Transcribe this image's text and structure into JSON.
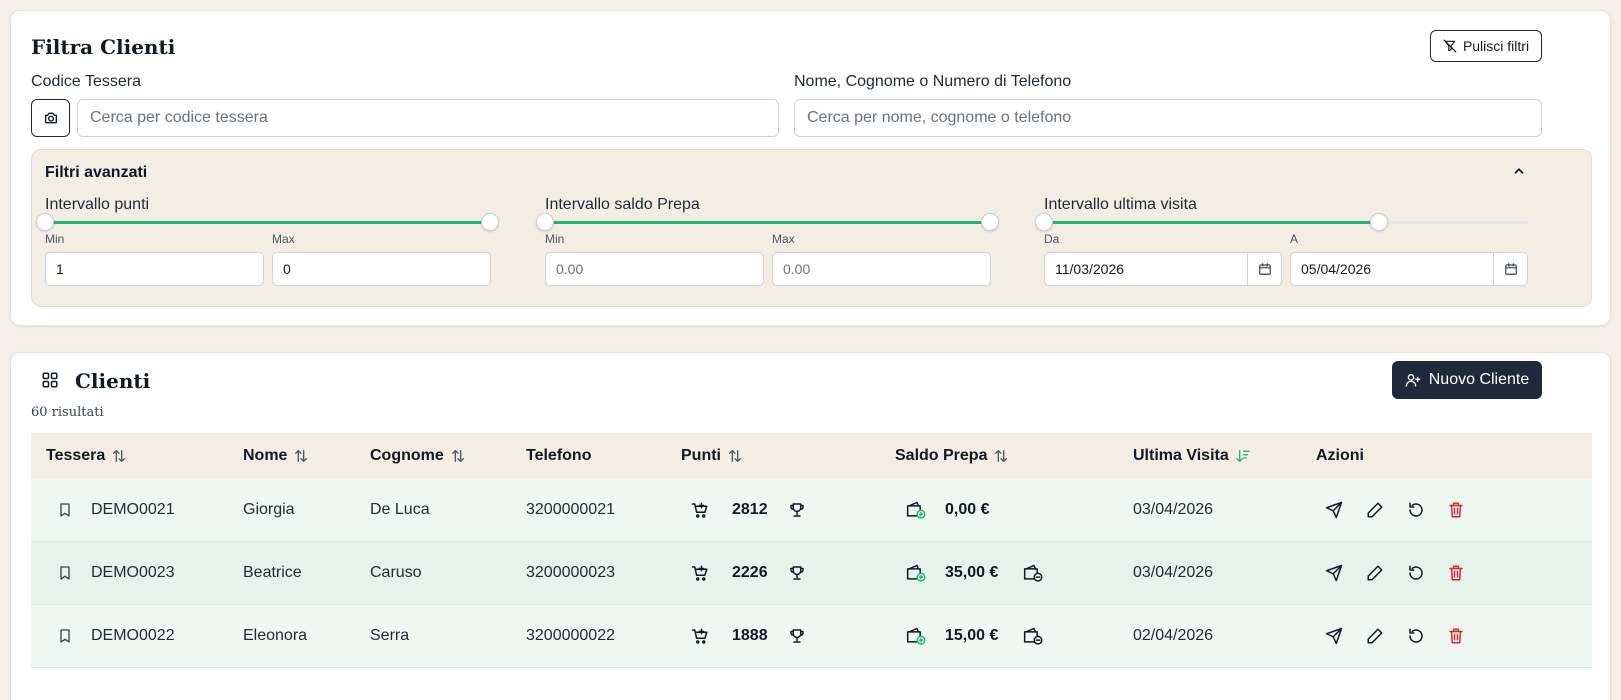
{
  "filters": {
    "title": "Filtra Clienti",
    "clear_label": "Pulisci filtri",
    "card_code_label": "Codice Tessera",
    "card_code_placeholder": "Cerca per codice tessera",
    "name_label": "Nome, Cognome o Numero di Telefono",
    "name_placeholder": "Cerca per nome, cognome o telefono",
    "advanced": {
      "title": "Filtri avanzati",
      "points": {
        "label": "Intervallo punti",
        "min_label": "Min",
        "max_label": "Max",
        "min_value": "1",
        "max_value": "0",
        "range_fill": [
          0,
          1
        ]
      },
      "prepaid": {
        "label": "Intervallo saldo Prepa",
        "min_label": "Min",
        "max_label": "Max",
        "min_placeholder": "0.00",
        "max_placeholder": "0.00",
        "range_fill": [
          0,
          1
        ]
      },
      "last_visit": {
        "label": "Intervallo ultima visita",
        "from_label": "Da",
        "to_label": "A",
        "from_value": "11/03/2026",
        "to_value": "05/04/2026",
        "range_fill": [
          0,
          0.69
        ]
      }
    }
  },
  "clients": {
    "title": "Clienti",
    "results": "60 risultati",
    "new_client_label": "Nuovo Cliente",
    "columns": {
      "card": "Tessera",
      "name": "Nome",
      "surname": "Cognome",
      "phone": "Telefono",
      "points": "Punti",
      "prepaid": "Saldo Prepa",
      "last_visit": "Ultima Visita",
      "actions": "Azioni"
    },
    "rows": [
      {
        "card": "DEMO0021",
        "name": "Giorgia",
        "surname": "De Luca",
        "phone": "3200000021",
        "points": "2812",
        "prepaid": "0,00 €",
        "last_visit": "03/04/2026",
        "has_withdraw": false
      },
      {
        "card": "DEMO0023",
        "name": "Beatrice",
        "surname": "Caruso",
        "phone": "3200000023",
        "points": "2226",
        "prepaid": "35,00 €",
        "last_visit": "03/04/2026",
        "has_withdraw": true
      },
      {
        "card": "DEMO0022",
        "name": "Eleonora",
        "surname": "Serra",
        "phone": "3200000022",
        "points": "1888",
        "prepaid": "15,00 €",
        "last_visit": "02/04/2026",
        "has_withdraw": true
      }
    ]
  },
  "colors": {
    "accent": "#22b573",
    "dark": "#1e293b",
    "danger": "#dc2626",
    "beige": "#f3ede4"
  }
}
